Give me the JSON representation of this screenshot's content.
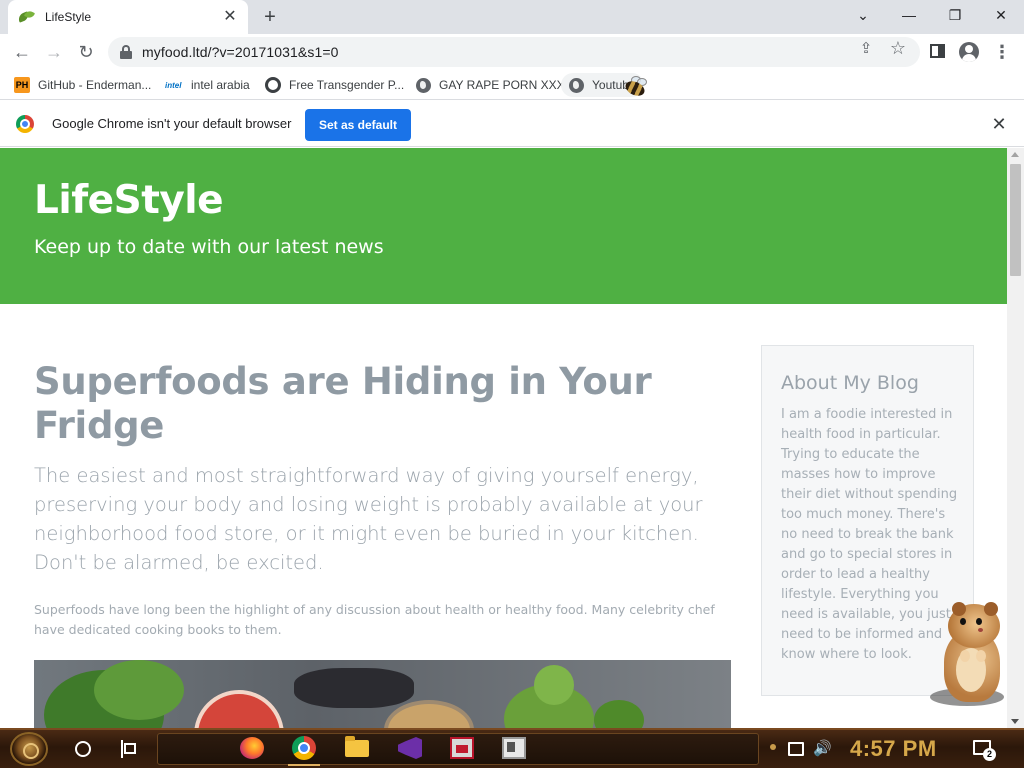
{
  "browser": {
    "tab": {
      "title": "LifeStyle",
      "close": "✕"
    },
    "new_tab": "+",
    "window_controls": {
      "dropdown": "⌄",
      "minimize": "—",
      "restore": "❐",
      "close": "✕"
    },
    "nav": {
      "back": "←",
      "forward": "→",
      "reload": "↻"
    },
    "address": {
      "url": "myfood.ltd/?v=20171031&s1=0"
    },
    "omnibox_icons": {
      "share": "⇪",
      "bookmark_star": "☆"
    },
    "menu": "⋮",
    "bookmarks": [
      {
        "label": "GitHub - Enderman...",
        "icon": "ph-icon",
        "icon_text": "PH"
      },
      {
        "label": "intel arabia",
        "icon": "intel-icon",
        "icon_text": "intel"
      },
      {
        "label": "Free Transgender P...",
        "icon": "gear-icon"
      },
      {
        "label": "GAY RAPE PORN XXX",
        "icon": "globe-icon"
      },
      {
        "label": "Youtube",
        "icon": "globe-icon"
      }
    ],
    "infobar": {
      "message": "Google Chrome isn't your default browser",
      "button": "Set as default",
      "close": "✕"
    }
  },
  "page": {
    "hero": {
      "title": "LifeStyle",
      "subtitle": "Keep up to date with our latest news",
      "background": "#4fb043"
    },
    "article": {
      "title": "Superfoods are Hiding in Your Fridge",
      "lead": "The easiest and most straightforward way of giving yourself energy, preserving your body and losing weight is probably available at your neighborhood food store, or it might even be buried in your kitchen. Don't be alarmed, be excited.",
      "body": "Superfoods have long been the highlight of any discussion about health or healthy food. Many celebrity chef have dedicated cooking books to them."
    },
    "sidebar": {
      "title": "About My Blog",
      "text": "I am a foodie interested in health food in particular. Trying to educate the masses how to improve their diet without spending too much money. There's no need to break the bank and go to special stores in order to lead a healthy lifestyle. Everything you need is available, you just need to be informed and know where to look."
    }
  },
  "taskbar": {
    "clock": "4:57 PM",
    "notification_count": "2",
    "volume": "🔊",
    "apps": [
      "firefox",
      "chrome",
      "file-explorer",
      "visual-studio",
      "red-app",
      "window-app"
    ]
  },
  "colors": {
    "accent_green": "#4fb043",
    "set_default_blue": "#1a73e8",
    "taskbar_brown": "#3a200e",
    "clock_gold": "#d6a84a"
  }
}
